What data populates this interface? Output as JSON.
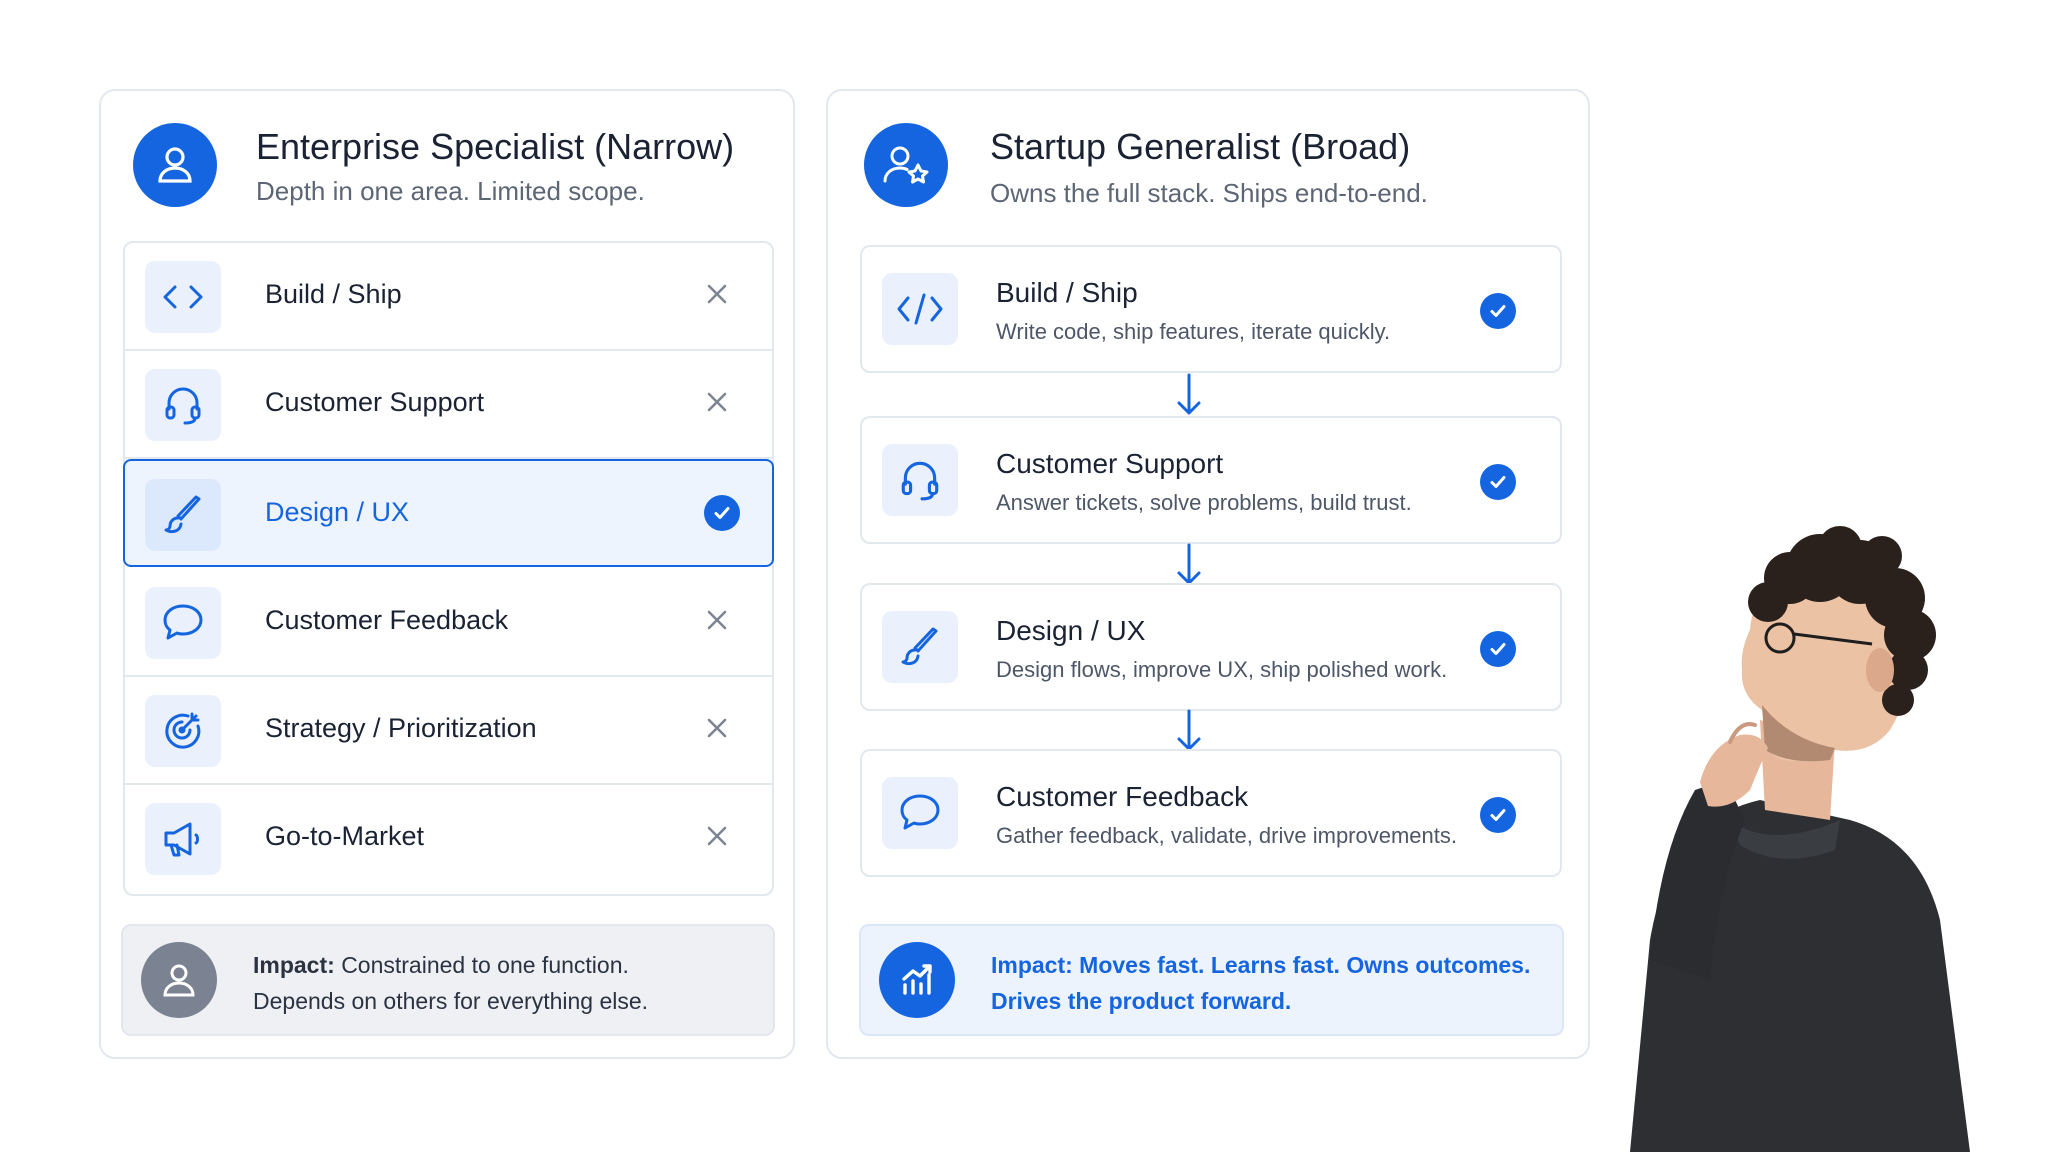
{
  "left_panel": {
    "title": "Enterprise Specialist (Narrow)",
    "subtitle": "Depth in one area. Limited scope.",
    "avatar_icon": "user-icon",
    "items": [
      {
        "label": "Build / Ship",
        "icon": "code-icon",
        "status": "x"
      },
      {
        "label": "Customer Support",
        "icon": "headset-icon",
        "status": "x"
      },
      {
        "label": "Design / UX",
        "icon": "brush-icon",
        "status": "check",
        "selected": true
      },
      {
        "label": "Customer Feedback",
        "icon": "chat-bubble-icon",
        "status": "x"
      },
      {
        "label": "Strategy / Prioritization",
        "icon": "target-icon",
        "status": "x"
      },
      {
        "label": "Go-to-Market",
        "icon": "megaphone-icon",
        "status": "x"
      }
    ],
    "impact": {
      "label": "Impact:",
      "line1": "Constrained to one function.",
      "line2": "Depends on others for everything else."
    }
  },
  "right_panel": {
    "title": "Startup Generalist (Broad)",
    "subtitle": "Owns the full stack. Ships end-to-end.",
    "avatar_icon": "user-star-icon",
    "cards": [
      {
        "title": "Build / Ship",
        "desc": "Write code, ship features, iterate quickly.",
        "icon": "code-icon",
        "status": "check"
      },
      {
        "title": "Customer Support",
        "desc": "Answer tickets, solve problems, build trust.",
        "icon": "headset-icon",
        "status": "check"
      },
      {
        "title": "Design / UX",
        "desc": "Design flows, improve UX, ship polished work.",
        "icon": "brush-icon",
        "status": "check"
      },
      {
        "title": "Customer Feedback",
        "desc": "Gather feedback, validate, drive improvements.",
        "icon": "chat-bubble-icon",
        "status": "check"
      }
    ],
    "impact": {
      "line1": "Impact: Moves fast. Learns fast. Owns outcomes.",
      "line2": "Drives the product forward."
    }
  },
  "colors": {
    "accent": "#1565e0",
    "border": "#e3e7ee",
    "muted_text": "#5d6675"
  }
}
